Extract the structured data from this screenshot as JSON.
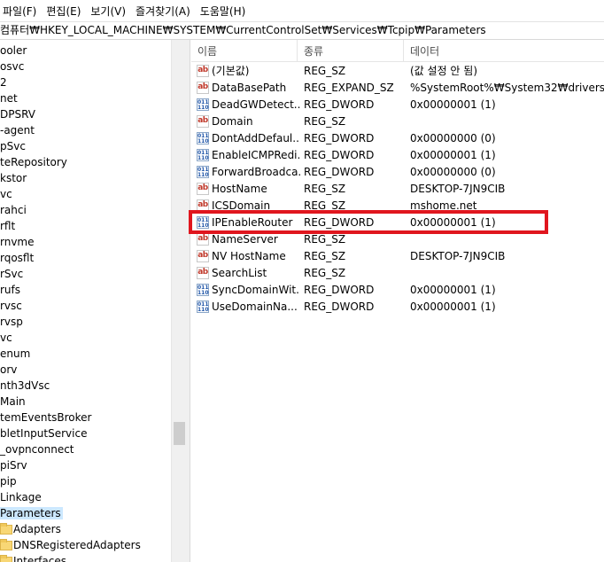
{
  "menu": [
    "파일(F)",
    "편집(E)",
    "보기(V)",
    "즐겨찾기(A)",
    "도움말(H)"
  ],
  "address": "컴퓨터₩HKEY_LOCAL_MACHINE₩SYSTEM₩CurrentControlSet₩Services₩Tcpip₩Parameters",
  "tree": {
    "items": [
      "ooler",
      "osvc",
      "2",
      "net",
      "DPSRV",
      "-agent",
      "pSvc",
      "teRepository",
      "kstor",
      "vc",
      "rahci",
      "rflt",
      "rnvme",
      "rqosflt",
      "rSvc",
      "rufs",
      "rvsc",
      "rvsp",
      "vc",
      "enum",
      "orv",
      "nth3dVsc",
      "Main",
      "temEventsBroker",
      "bletInputService",
      "_ovpnconnect",
      "piSrv",
      "pip",
      "Linkage",
      "Parameters"
    ],
    "children": [
      "Adapters",
      "DNSRegisteredAdapters",
      "Interfaces"
    ]
  },
  "list": {
    "headers": {
      "name": "이름",
      "type": "종류",
      "data": "데이터"
    },
    "rows": [
      {
        "icon": "string-value-icon",
        "name": "(기본값)",
        "type": "REG_SZ",
        "data": "(값 설정 안 됨)"
      },
      {
        "icon": "string-value-icon",
        "name": "DataBasePath",
        "type": "REG_EXPAND_SZ",
        "data": "%SystemRoot%₩System32₩drivers₩etc"
      },
      {
        "icon": "binary-value-icon",
        "name": "DeadGWDetect...",
        "type": "REG_DWORD",
        "data": "0x00000001 (1)"
      },
      {
        "icon": "string-value-icon",
        "name": "Domain",
        "type": "REG_SZ",
        "data": ""
      },
      {
        "icon": "binary-value-icon",
        "name": "DontAddDefaul...",
        "type": "REG_DWORD",
        "data": "0x00000000 (0)"
      },
      {
        "icon": "binary-value-icon",
        "name": "EnableICMPRedi...",
        "type": "REG_DWORD",
        "data": "0x00000001 (1)"
      },
      {
        "icon": "binary-value-icon",
        "name": "ForwardBroadca...",
        "type": "REG_DWORD",
        "data": "0x00000000 (0)"
      },
      {
        "icon": "string-value-icon",
        "name": "HostName",
        "type": "REG_SZ",
        "data": "DESKTOP-7JN9CIB"
      },
      {
        "icon": "string-value-icon",
        "name": "ICSDomain",
        "type": "REG_SZ",
        "data": "mshome.net"
      },
      {
        "icon": "binary-value-icon",
        "name": "IPEnableRouter",
        "type": "REG_DWORD",
        "data": "0x00000001 (1)"
      },
      {
        "icon": "string-value-icon",
        "name": "NameServer",
        "type": "REG_SZ",
        "data": ""
      },
      {
        "icon": "string-value-icon",
        "name": "NV HostName",
        "type": "REG_SZ",
        "data": "DESKTOP-7JN9CIB"
      },
      {
        "icon": "string-value-icon",
        "name": "SearchList",
        "type": "REG_SZ",
        "data": ""
      },
      {
        "icon": "binary-value-icon",
        "name": "SyncDomainWit...",
        "type": "REG_DWORD",
        "data": "0x00000001 (1)"
      },
      {
        "icon": "binary-value-icon",
        "name": "UseDomainNa...",
        "type": "REG_DWORD",
        "data": "0x00000001 (1)"
      }
    ]
  },
  "colors": {
    "highlight": "#e0161e",
    "selection": "#cce8ff",
    "folder": "#f8d775"
  },
  "icons": {
    "string": "string-value-icon",
    "binary": "binary-value-icon",
    "folder": "folder-icon"
  },
  "icon_glyphs": {
    "string": "ab",
    "binary": "011\n110"
  }
}
